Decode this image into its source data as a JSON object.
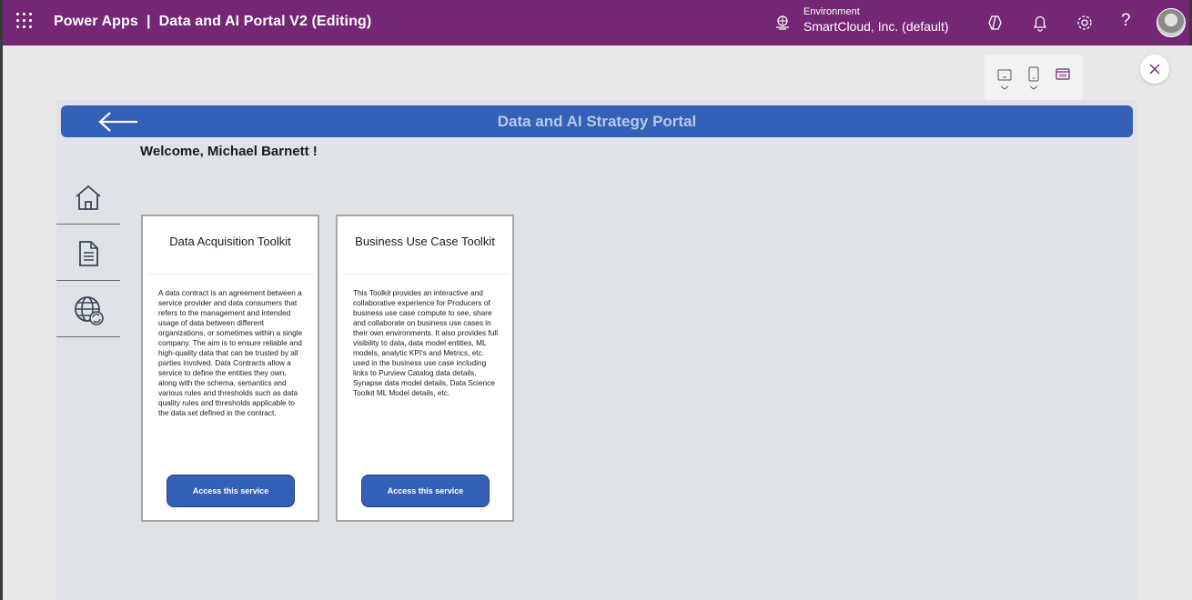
{
  "topbar": {
    "title": "Power Apps  |  Data and AI Portal V2 (Editing)",
    "environment_label": "Environment",
    "environment_name": "SmartCloud, Inc. (default)",
    "help_glyph": "?",
    "bg_color": "#742774"
  },
  "app": {
    "header_title": "Data and AI Strategy Portal",
    "welcome_text": "Welcome, Michael Barnett !",
    "header_color": "#3461b7",
    "nav_items": [
      {
        "name": "home",
        "icon": "home-icon"
      },
      {
        "name": "document",
        "icon": "document-icon"
      },
      {
        "name": "globe",
        "icon": "globe-sync-icon"
      }
    ],
    "cards": [
      {
        "title": "Data Acquisition Toolkit",
        "description": "A data contract is an agreement between a service provider and data consumers that refers to the management and intended usage of data between different organizations, or sometimes within a single company. The aim is to ensure reliable and high-quality data that can be trusted by all parties involved.  Data Contracts allow a service to define the entities they own, along with the schema, semantics and various rules and thresholds such as data quality rules and thresholds applicable to the data set defined in the contract.",
        "button_label": "Access this service"
      },
      {
        "title": "Business Use Case Toolkit",
        "description": "This Toolkit provides an interactive and collaborative experience for Producers of business use case compute to see, share and collaborate on business use cases in their own environments. It also provides full visibility to data, data model entities, ML models, analytic KPI's and Metrics, etc. used in the business use case including links to Purview Catalog data details, Synapse data model details, Data Science Toolkit ML Model details, etc.",
        "button_label": "Access this service"
      }
    ]
  }
}
